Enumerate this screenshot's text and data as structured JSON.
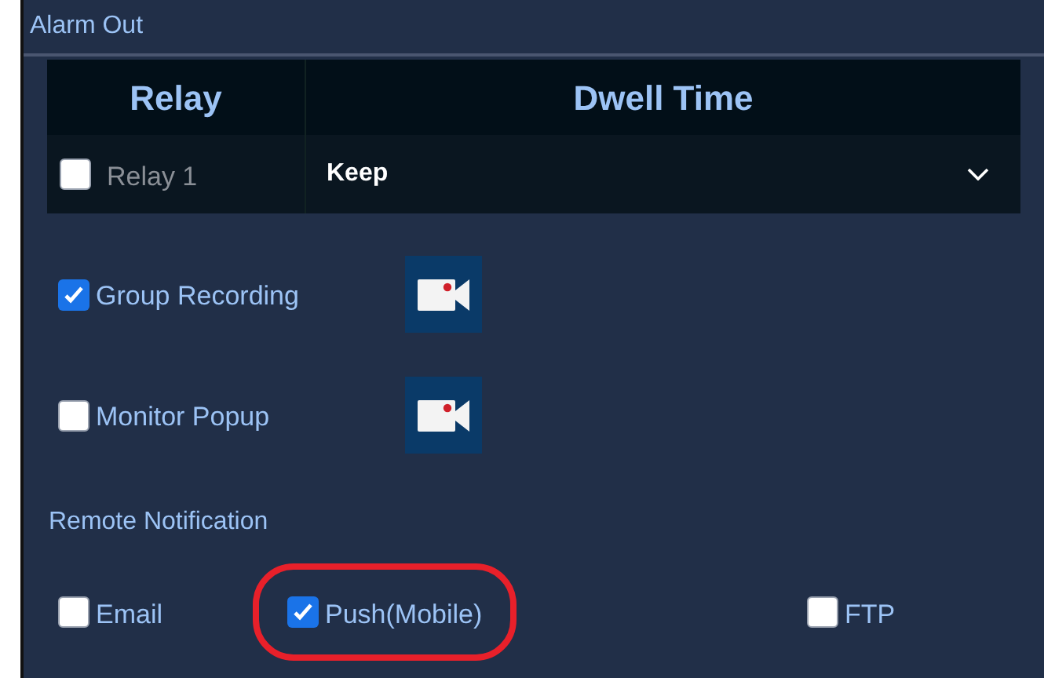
{
  "panel": {
    "title": "Alarm Out"
  },
  "relay_table": {
    "columns": [
      "Relay",
      "Dwell Time"
    ],
    "rows": [
      {
        "label": "Relay 1",
        "checked": false,
        "dwell_time": "Keep"
      }
    ]
  },
  "options": [
    {
      "label": "Group Recording",
      "checked": true
    },
    {
      "label": "Monitor Popup",
      "checked": false
    }
  ],
  "remote_notification": {
    "heading": "Remote Notification",
    "items": [
      {
        "label": "Email",
        "checked": false,
        "highlighted": false
      },
      {
        "label": "Push(Mobile)",
        "checked": true,
        "highlighted": true
      },
      {
        "label": "FTP",
        "checked": false,
        "highlighted": false
      }
    ]
  }
}
